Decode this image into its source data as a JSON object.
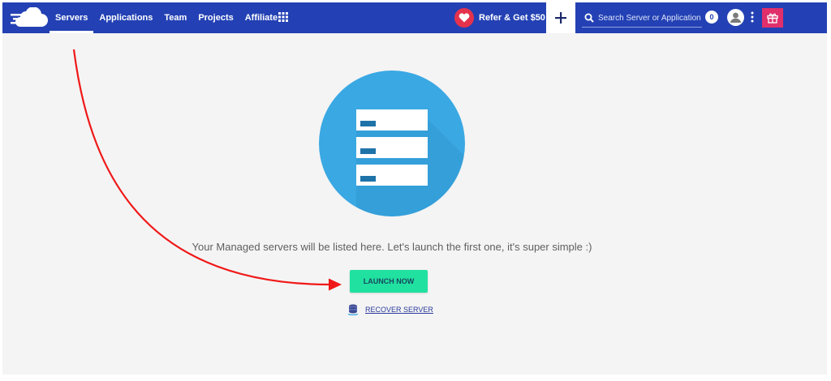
{
  "nav": {
    "items": [
      {
        "label": "Servers",
        "active": true
      },
      {
        "label": "Applications",
        "active": false
      },
      {
        "label": "Team",
        "active": false
      },
      {
        "label": "Projects",
        "active": false
      },
      {
        "label": "Affiliate",
        "active": false
      }
    ]
  },
  "header": {
    "refer_label": "Refer & Get $50",
    "search_placeholder": "Search Server or Application",
    "notification_count": "0"
  },
  "icons": {
    "logo": "cloud-logo-icon",
    "apps": "grid-icon",
    "refer": "heart-icon",
    "add": "plus-icon",
    "search": "search-icon",
    "user": "user-icon",
    "more": "kebab-menu-icon",
    "gift": "gift-icon",
    "hero": "server-stack-icon",
    "recover": "database-icon"
  },
  "main": {
    "empty_message": "Your Managed servers will be listed here. Let's launch the first one, it's super simple :)",
    "launch_label": "LAUNCH NOW",
    "recover_label": "RECOVER SERVER"
  },
  "colors": {
    "header_bg": "#2341b4",
    "launch_button": "#20e1a0",
    "hero_circle": "#3aa8e3",
    "refer_heart": "#e4324d",
    "gift_bg": "#e02f6b",
    "annotation_arrow": "#f01818"
  }
}
